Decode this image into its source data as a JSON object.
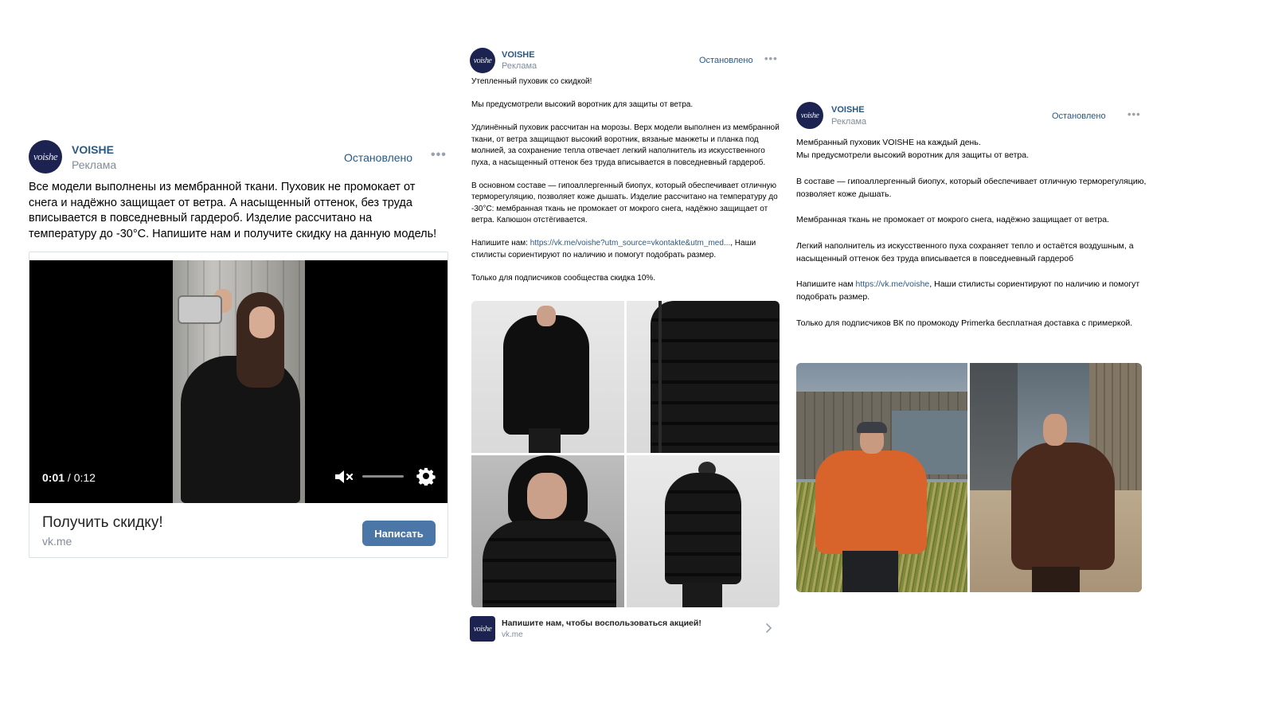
{
  "colors": {
    "link": "#2a5885",
    "button": "#4a76a8",
    "muted": "#818c99",
    "brand_avatar": "#1c2350"
  },
  "post1": {
    "avatar_text": "voishe",
    "brand": "VOISHE",
    "sub": "Реклама",
    "status": "Остановлено",
    "menu": "•••",
    "text": "Все модели выполнены из мембранной ткани. Пуховик не промокает от снега и надёжно защищает от ветра. А насыщенный оттенок, без труда вписывается в повседневный гардероб. Изделие рассчитано на температуру до -30°С. Напишите нам и получите скидку на данную модель!",
    "video": {
      "current": "0:01",
      "separator": " / ",
      "total": "0:12",
      "mute_icon": "mute-icon",
      "settings_icon": "gear-icon",
      "volume": 0
    },
    "cta": {
      "title": "Получить скидку!",
      "url": "vk.me",
      "button": "Написать"
    }
  },
  "post2": {
    "avatar_text": "voishe",
    "brand": "VOISHE",
    "sub": "Реклама",
    "status": "Остановлено",
    "menu": "•••",
    "paragraphs": [
      "Утепленный пуховик со скидкой!",
      "Мы предусмотрели высокий воротник для защиты от ветра.",
      "Удлинённый пуховик рассчитан на морозы. Верх модели выполнен из мембранной ткани, от ветра защищают высокий воротник, вязаные манжеты и планка под молнией, за сохранение тепла отвечает легкий наполнитель из искусственного пуха, а насыщенный оттенок без труда вписывается в повседневный гардероб.",
      "В основном составе — гипоаллергенный биопух, который обеспечивает отличную терморегуляцию, позволяет коже дышать. Изделие рассчитано на температуру до -30°С: мембранная ткань не промокает от мокрого снега, надёжно защищает от ветра. Капюшон отстёгивается."
    ],
    "contact_prefix": "Напишите нам: ",
    "contact_link": "https://vk.me/voishe?utm_source=vkontakte&utm_med...",
    "contact_suffix": ", Наши стилисты сориентируют по наличию и помогут подобрать размер.",
    "promo": "Только для подписчиков сообщества скидка 10%.",
    "footer": {
      "avatar_text": "voishe",
      "title": "Напишите нам, чтобы воспользоваться акцией!",
      "url": "vk.me"
    }
  },
  "post3": {
    "avatar_text": "voishe",
    "brand": "VOISHE",
    "sub": "Реклама",
    "status": "Остановлено",
    "menu": "•••",
    "para1_line1": "Мембранный пуховик VOISHE на каждый день.",
    "para1_line2": "Мы предусмотрели высокий воротник для защиты от ветра.",
    "para2": "В составе — гипоаллергенный биопух, который обеспечивает отличную терморегуляцию, позволяет коже дышать.",
    "para3": "Мембранная ткань не промокает от мокрого снега, надёжно защищает от ветра.",
    "para4": "Легкий наполнитель из искусственного пуха сохраняет тепло и остаётся воздушным, а насыщенный оттенок без труда вписывается в повседневный гардероб",
    "contact_prefix": "Напишите нам ",
    "contact_link": "https://vk.me/voishe",
    "contact_suffix": ", Наши стилисты сориентируют по наличию и помогут подобрать размер.",
    "promo": "Только для подписчиков ВК по промокоду Primerka бесплатная доставка с примеркой."
  }
}
